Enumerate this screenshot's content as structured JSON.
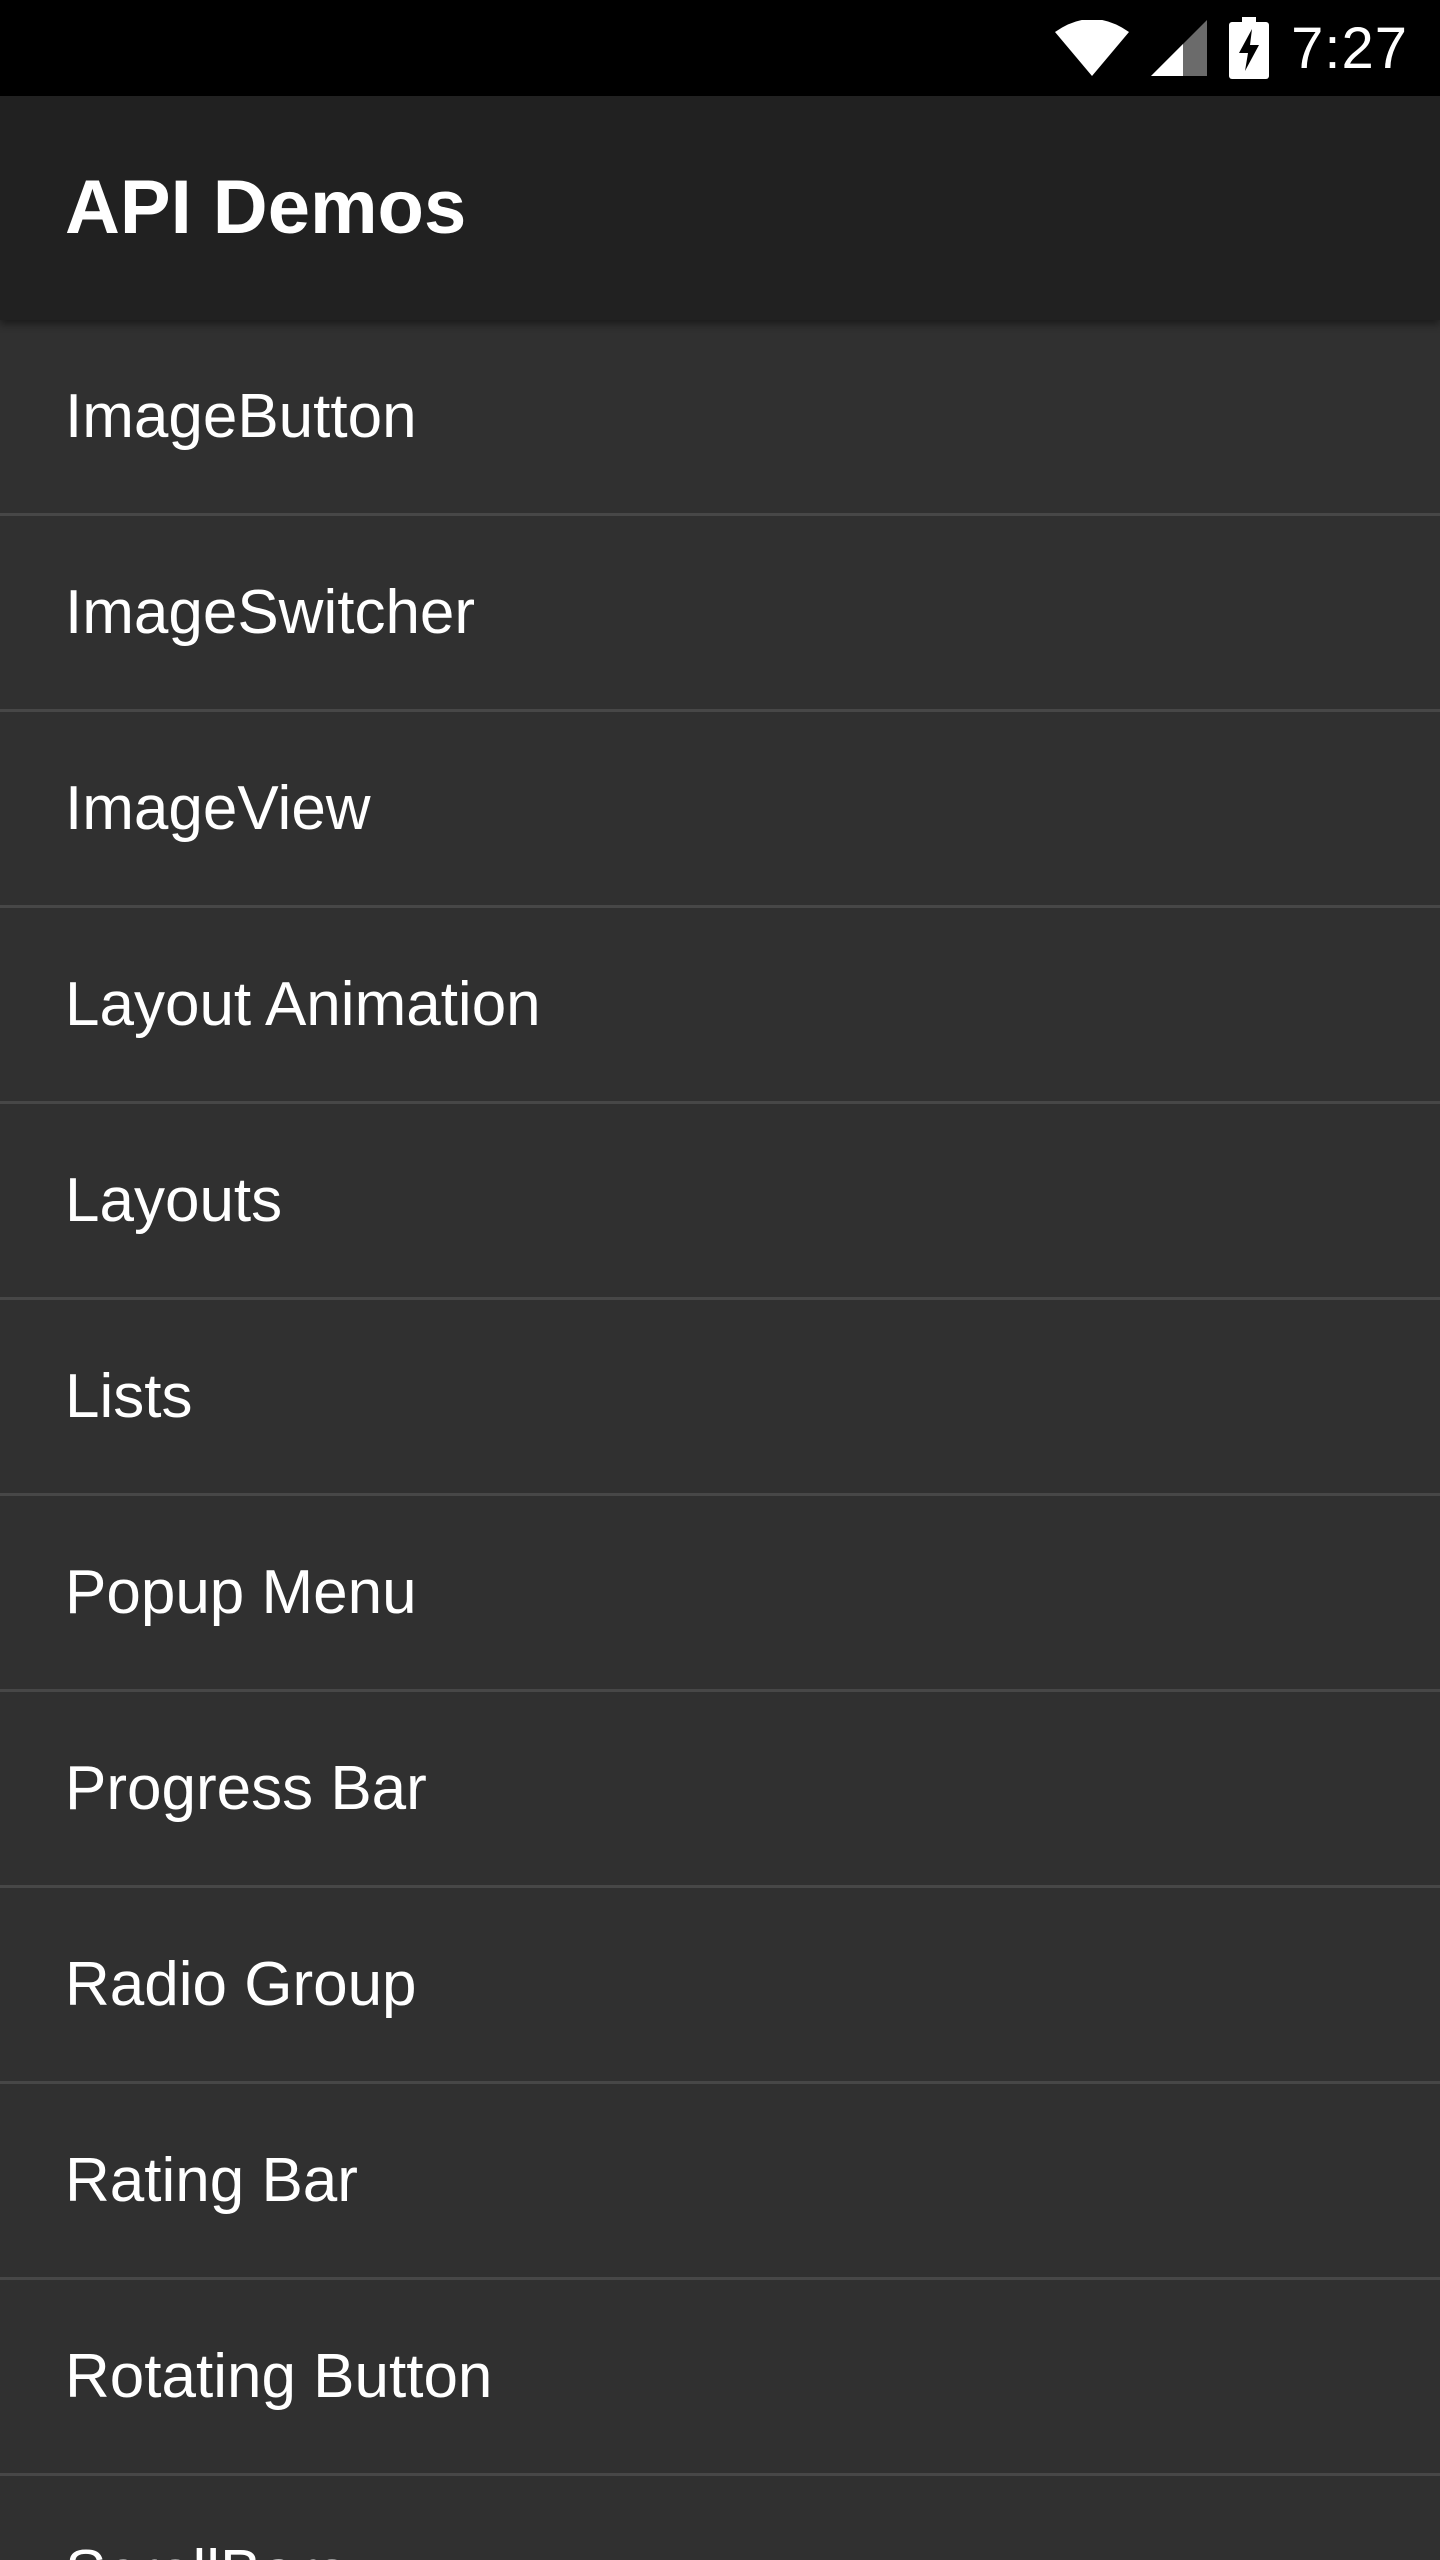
{
  "status_bar": {
    "time": "7:27",
    "icons": [
      "wifi-icon",
      "cell-signal-icon",
      "battery-charging-icon"
    ]
  },
  "app_bar": {
    "title": "API Demos"
  },
  "list": {
    "items": [
      {
        "label": "ImageButton"
      },
      {
        "label": "ImageSwitcher"
      },
      {
        "label": "ImageView"
      },
      {
        "label": "Layout Animation"
      },
      {
        "label": "Layouts"
      },
      {
        "label": "Lists"
      },
      {
        "label": "Popup Menu"
      },
      {
        "label": "Progress Bar"
      },
      {
        "label": "Radio Group"
      },
      {
        "label": "Rating Bar"
      },
      {
        "label": "Rotating Button"
      },
      {
        "label": "ScrollBars"
      }
    ]
  },
  "colors": {
    "status_bar_bg": "#000000",
    "app_bar_bg": "#212121",
    "list_bg": "#303030",
    "divider": "#474747",
    "text": "#ffffff"
  }
}
